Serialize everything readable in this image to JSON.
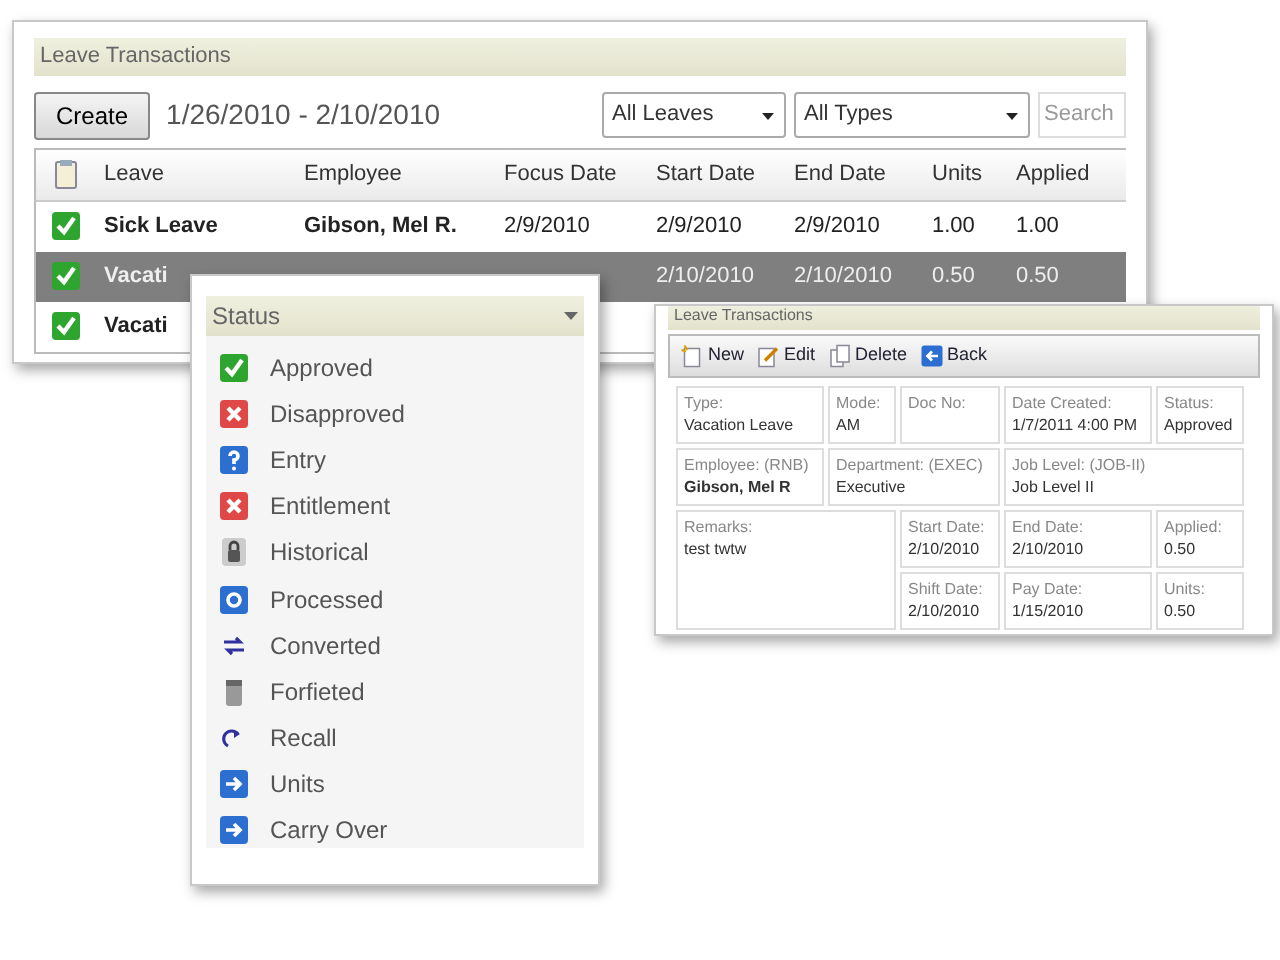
{
  "transactions_panel": {
    "title": "Leave Transactions",
    "create_button": "Create",
    "date_range": "1/26/2010 - 2/10/2010",
    "filters": [
      {
        "value": "All Leaves"
      },
      {
        "value": "All Types"
      }
    ],
    "search": {
      "placeholder": "Search"
    },
    "table": {
      "columns": [
        "Leave",
        "Employee",
        "Focus Date",
        "Start Date",
        "End Date",
        "Units",
        "Applied"
      ],
      "rows": [
        {
          "kind": "approved",
          "selected": false,
          "cells": [
            "Sick Leave",
            "Gibson, Mel R.",
            "2/9/2010",
            "2/9/2010",
            "2/9/2010",
            "1.00",
            "1.00"
          ]
        },
        {
          "kind": "approved",
          "selected": true,
          "cells": [
            "Vacati",
            "",
            "",
            "2/10/2010",
            "2/10/2010",
            "0.50",
            "0.50"
          ]
        },
        {
          "kind": "approved",
          "selected": false,
          "cells": [
            "Vacati"
          ]
        }
      ]
    }
  },
  "status_legend": {
    "title": "Status",
    "items": [
      {
        "kind": "approved",
        "label": "Approved"
      },
      {
        "kind": "disapproved",
        "label": "Disapproved"
      },
      {
        "kind": "entry",
        "label": "Entry"
      },
      {
        "kind": "entitlement",
        "label": "Entitlement"
      },
      {
        "kind": "historical",
        "label": "Historical"
      },
      {
        "kind": "processed",
        "label": "Processed"
      },
      {
        "kind": "converted",
        "label": "Converted"
      },
      {
        "kind": "forfeited",
        "label": "Forfieted"
      },
      {
        "kind": "recall",
        "label": "Recall"
      },
      {
        "kind": "units",
        "label": "Units"
      },
      {
        "kind": "carry_over",
        "label": "Carry Over"
      }
    ]
  },
  "detail_panel": {
    "title": "Leave Transactions",
    "toolbar": [
      {
        "kind": "new",
        "label": "New"
      },
      {
        "kind": "edit",
        "label": "Edit"
      },
      {
        "kind": "delete",
        "label": "Delete"
      },
      {
        "kind": "back",
        "label": "Back"
      }
    ],
    "fields": [
      {
        "label": "Type:",
        "value": "Vacation Leave"
      },
      {
        "label": "Mode:",
        "value": "AM"
      },
      {
        "label": "Doc No:"
      },
      {
        "label": "Date Created:",
        "value": "1/7/2011 4:00 PM"
      },
      {
        "label": "Status:",
        "value": "Approved"
      },
      {
        "label": "Employee: (RNB)",
        "value": "Gibson, Mel R",
        "emphasis": true
      },
      {
        "label": "Department: (EXEC)",
        "value": "Executive"
      },
      {
        "label": "Job Level: (JOB-II)",
        "value": "Job Level II"
      },
      {
        "label": "Remarks:",
        "value": "test twtw"
      },
      {
        "label": "Start Date:",
        "value": "2/10/2010"
      },
      {
        "label": "End Date:",
        "value": "2/10/2010"
      },
      {
        "label": "Applied:",
        "value": "0.50"
      },
      {
        "label": "Shift Date:",
        "value": "2/10/2010"
      },
      {
        "label": "Pay Date:",
        "value": "1/15/2010"
      },
      {
        "label": "Units:",
        "value": "0.50"
      }
    ]
  }
}
